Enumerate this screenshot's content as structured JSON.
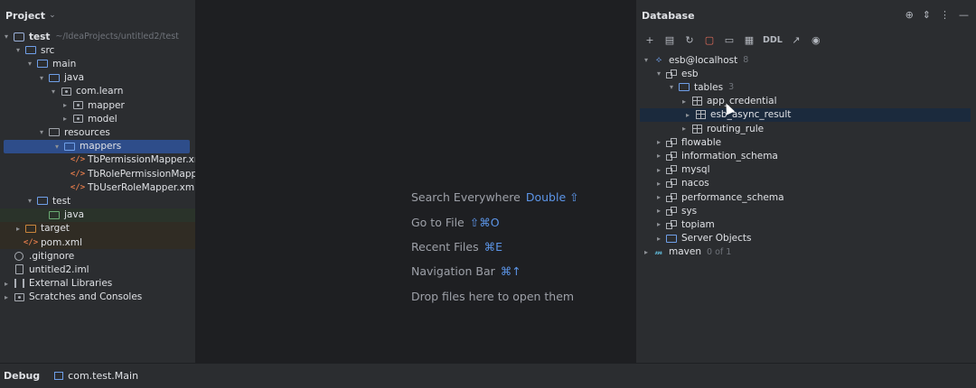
{
  "project": {
    "title": "Project",
    "tree": [
      {
        "label": "test",
        "muted": "~/IdeaProjects/untitled2/test",
        "depth": 0,
        "arrow": "down",
        "icon": "project-icon",
        "bold": true
      },
      {
        "label": "src",
        "depth": 1,
        "arrow": "down",
        "icon": "folder-icon"
      },
      {
        "label": "main",
        "depth": 2,
        "arrow": "down",
        "icon": "folder-icon"
      },
      {
        "label": "java",
        "depth": 3,
        "arrow": "down",
        "icon": "source-folder-icon"
      },
      {
        "label": "com.learn",
        "depth": 4,
        "arrow": "down",
        "icon": "package-icon"
      },
      {
        "label": "mapper",
        "depth": 5,
        "arrow": "right",
        "icon": "package-icon"
      },
      {
        "label": "model",
        "depth": 5,
        "arrow": "right",
        "icon": "package-icon"
      },
      {
        "label": "resources",
        "depth": 3,
        "arrow": "down",
        "icon": "resources-folder-icon"
      },
      {
        "label": "mappers",
        "depth": 4,
        "arrow": "down",
        "icon": "folder-icon",
        "state": "selected"
      },
      {
        "label": "TbPermissionMapper.xml",
        "depth": 5,
        "arrow": "none",
        "icon": "xml-file-icon"
      },
      {
        "label": "TbRolePermissionMapper.xml",
        "depth": 5,
        "arrow": "none",
        "icon": "xml-file-icon"
      },
      {
        "label": "TbUserRoleMapper.xml",
        "depth": 5,
        "arrow": "none",
        "icon": "xml-file-icon"
      },
      {
        "label": "test",
        "depth": 2,
        "arrow": "down",
        "icon": "folder-icon"
      },
      {
        "label": "java",
        "depth": 3,
        "arrow": "none",
        "icon": "test-folder-icon",
        "state": "green"
      },
      {
        "label": "target",
        "depth": 1,
        "arrow": "right",
        "icon": "excluded-folder-icon",
        "state": "brown"
      },
      {
        "label": "pom.xml",
        "depth": 1,
        "arrow": "none",
        "icon": "maven-file-icon",
        "state": "brown"
      },
      {
        "label": ".gitignore",
        "depth": 0,
        "arrow": "none",
        "icon": "ignore-file-icon"
      },
      {
        "label": "untitled2.iml",
        "depth": 0,
        "arrow": "none",
        "icon": "file-icon"
      },
      {
        "label": "External Libraries",
        "depth": 0,
        "arrow": "right",
        "icon": "library-icon",
        "flush": true
      },
      {
        "label": "Scratches and Consoles",
        "depth": 0,
        "arrow": "right",
        "icon": "scratches-icon",
        "flush": true
      }
    ]
  },
  "editor": {
    "hints": [
      {
        "label": "Search Everywhere",
        "key": "Double ⇧"
      },
      {
        "label": "Go to File",
        "key": "⇧⌘O"
      },
      {
        "label": "Recent Files",
        "key": "⌘E"
      },
      {
        "label": "Navigation Bar",
        "key": "⌘↑"
      },
      {
        "label": "Drop files here to open them",
        "key": ""
      }
    ]
  },
  "database": {
    "title": "Database",
    "header_icons": [
      "target-icon",
      "expand-collapse-icon",
      "more-icon",
      "minimize-icon"
    ],
    "toolbar": [
      "add-icon",
      "data-source-icon",
      "refresh-icon",
      "stop-icon",
      "console-icon",
      "table-view-icon",
      "DDL",
      "jump-icon",
      "view-icon"
    ],
    "tree": [
      {
        "label": "esb@localhost",
        "muted": "8",
        "depth": 0,
        "arrow": "down",
        "icon": "datasource-icon"
      },
      {
        "label": "esb",
        "depth": 1,
        "arrow": "down",
        "icon": "schema-icon"
      },
      {
        "label": "tables",
        "muted": "3",
        "depth": 2,
        "arrow": "down",
        "icon": "folder-icon"
      },
      {
        "label": "app_credential",
        "depth": 3,
        "arrow": "right",
        "icon": "table-icon"
      },
      {
        "label": "esb_async_result",
        "depth": 3,
        "arrow": "right",
        "icon": "table-icon",
        "state": "hover"
      },
      {
        "label": "routing_rule",
        "depth": 3,
        "arrow": "right",
        "icon": "table-icon"
      },
      {
        "label": "flowable",
        "depth": 1,
        "arrow": "right",
        "icon": "schema-icon"
      },
      {
        "label": "information_schema",
        "depth": 1,
        "arrow": "right",
        "icon": "schema-icon"
      },
      {
        "label": "mysql",
        "depth": 1,
        "arrow": "right",
        "icon": "schema-icon"
      },
      {
        "label": "nacos",
        "depth": 1,
        "arrow": "right",
        "icon": "schema-icon"
      },
      {
        "label": "performance_schema",
        "depth": 1,
        "arrow": "right",
        "icon": "schema-icon"
      },
      {
        "label": "sys",
        "depth": 1,
        "arrow": "right",
        "icon": "schema-icon"
      },
      {
        "label": "topiam",
        "depth": 1,
        "arrow": "right",
        "icon": "schema-icon"
      },
      {
        "label": "Server Objects",
        "depth": 1,
        "arrow": "right",
        "icon": "folder-icon"
      },
      {
        "label": "maven",
        "muted": "0 of 1",
        "depth": 0,
        "arrow": "right",
        "icon": "maven-icon"
      }
    ]
  },
  "status": {
    "tool": "Debug",
    "run_config": "com.test.Main"
  },
  "colors": {
    "accent": "#5c95e8",
    "selection": "#2e4d8a",
    "panel": "#2b2d30",
    "editor": "#1e1f22"
  }
}
